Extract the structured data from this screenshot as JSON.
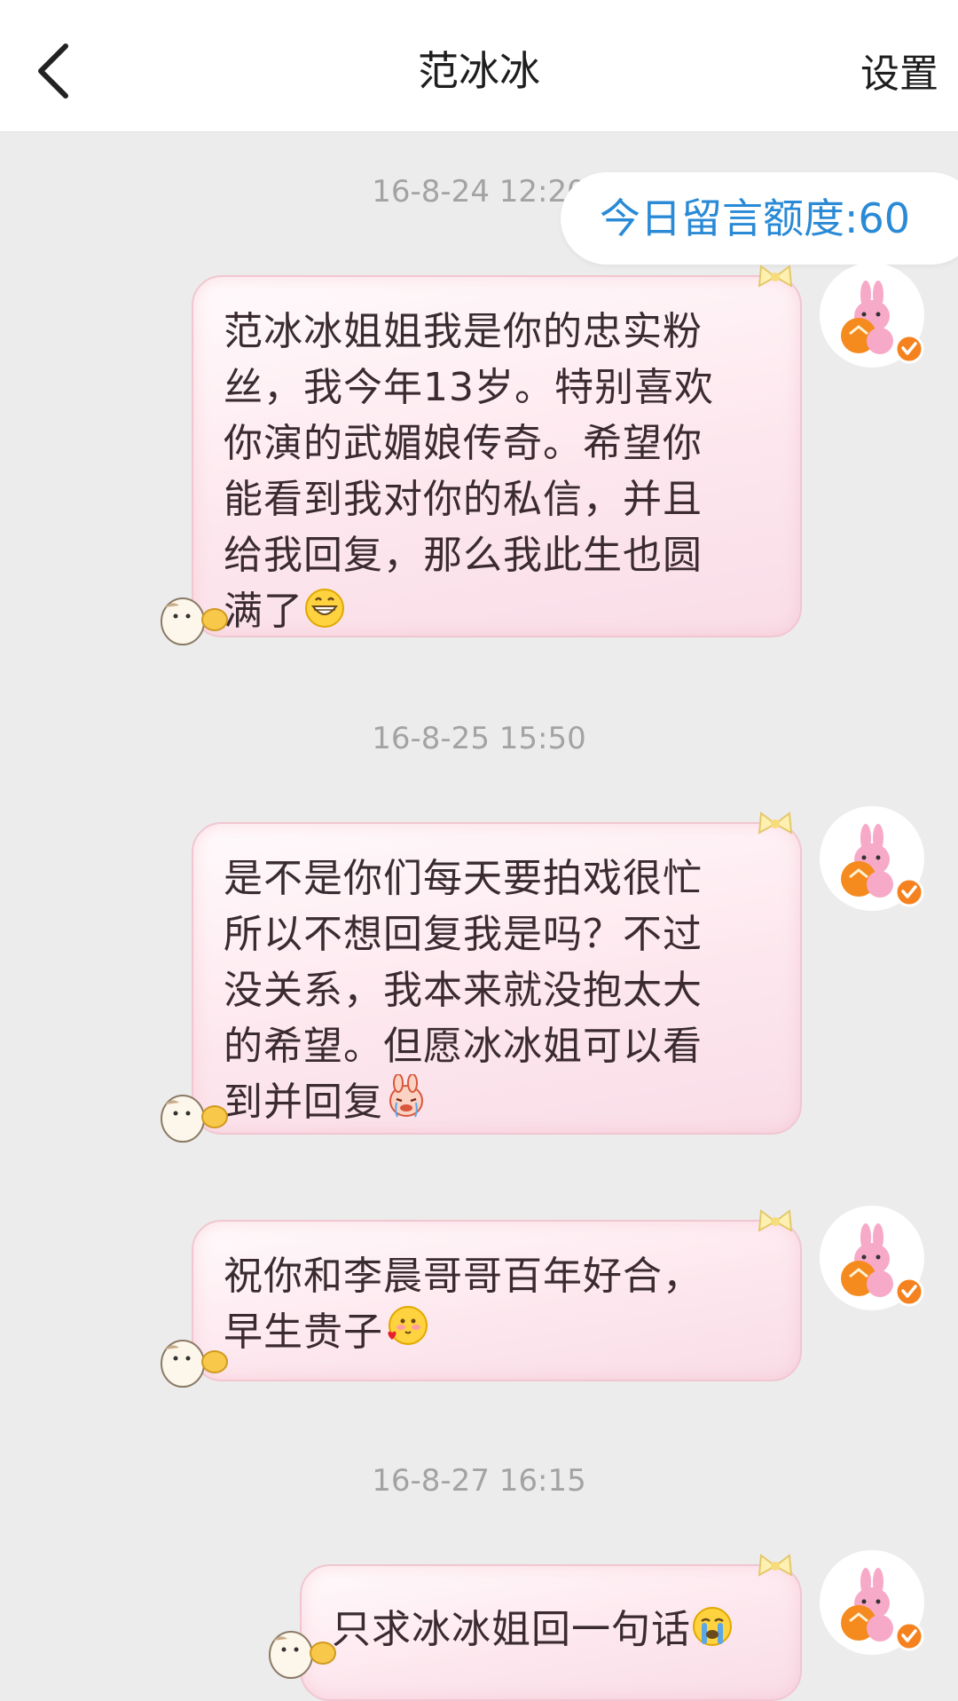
{
  "header": {
    "title": "范冰冰",
    "settings_label": "设置",
    "back_icon": "chevron-left-icon"
  },
  "quota": {
    "label": "今日留言额度:60"
  },
  "messages": [
    {
      "time": "16-8-24 12:20",
      "text": "范冰冰姐姐我是你的忠实粉\n丝，我今年13岁。特别喜欢\n你演的武媚娘传奇。希望你\n能看到我对你的私信，并且\n给我回复，那么我此生也圆\n满了",
      "emoji": "grinning-face-icon"
    },
    {
      "time": "16-8-25 15:50",
      "text": "是不是你们每天要拍戏很忙\n所以不想回复我是吗？不过\n没关系，我本来就没抱太大\n的希望。但愿冰冰姐可以看\n到并回复",
      "emoji": "crying-bunny-sticker-icon"
    },
    {
      "text": "祝你和李晨哥哥百年好合，\n早生贵子",
      "emoji": "blushing-heart-face-icon"
    },
    {
      "time": "16-8-27 16:15",
      "text": "只求冰冰姐回一句话",
      "emoji": "loudly-crying-face-icon"
    }
  ],
  "colors": {
    "accent": "#2a8ad6",
    "bubble_border": "#f1c6d0",
    "verified_badge": "#f5821f",
    "timestamp": "#a3a3a3"
  }
}
